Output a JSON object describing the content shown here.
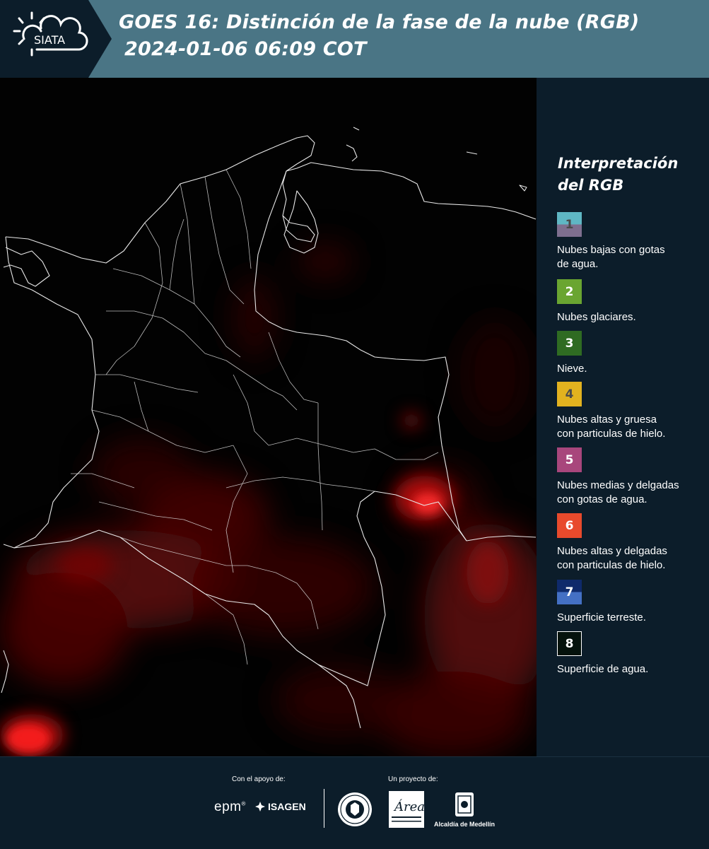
{
  "header": {
    "logo_text": "SIATA",
    "title_line1": "GOES 16: Distinción de la fase de la nube (RGB)",
    "title_line2": "2024-01-06 06:09 COT"
  },
  "legend": {
    "title_line1": "Interpretación",
    "title_line2": "del RGB",
    "items": [
      {
        "number": "1",
        "label_line1": "Nubes bajas con gotas",
        "label_line2": "de agua.",
        "color_top": "#5fb7c4",
        "color_bottom": "#7e6f8f",
        "text_color": "#4a4a4a"
      },
      {
        "number": "2",
        "label_line1": "Nubes glaciares.",
        "label_line2": "",
        "color_top": "#6aa531",
        "color_bottom": "#6aa531",
        "text_color": "#ffffff"
      },
      {
        "number": "3",
        "label_line1": "Nieve.",
        "label_line2": "",
        "color_top": "#2f6b22",
        "color_bottom": "#2f6b22",
        "text_color": "#ffffff"
      },
      {
        "number": "4",
        "label_line1": "Nubes altas y gruesa",
        "label_line2": "con particulas de hielo.",
        "color_top": "#e2b21f",
        "color_bottom": "#e2b21f",
        "text_color": "#4a4a4a"
      },
      {
        "number": "5",
        "label_line1": "Nubes medias y delgadas",
        "label_line2": "con gotas de agua.",
        "color_top": "#a8467c",
        "color_bottom": "#a8467c",
        "text_color": "#ffffff"
      },
      {
        "number": "6",
        "label_line1": "Nubes altas y delgadas",
        "label_line2": "con particulas de hielo.",
        "color_top": "#e84a2c",
        "color_bottom": "#e84a2c",
        "text_color": "#ffffff"
      },
      {
        "number": "7",
        "label_line1": "Superficie terreste.",
        "label_line2": "",
        "color_top": "#0f2a6b",
        "color_bottom": "#4470c4",
        "text_color": "#ffffff"
      },
      {
        "number": "8",
        "label_line1": "Superficie de agua.",
        "label_line2": "",
        "color_top": "#05120c",
        "color_bottom": "#05120c",
        "text_color": "#ffffff"
      }
    ]
  },
  "footer": {
    "support_label": "Con el apoyo de:",
    "project_label": "Un proyecto de:",
    "epm_logo": "epm",
    "isagen_logo": "ISAGEN",
    "area_logo": "Área Metropolitana Valle de Aburrá",
    "alcaldia_logo": "Alcaldía de Medellín"
  },
  "colors": {
    "header_bg": "#4a7585",
    "logo_bg": "#0c1d2a",
    "panel_bg": "#0c1d2a",
    "map_bg": "#020202",
    "cloud_red": "#e81010",
    "border_white": "#ffffff"
  }
}
